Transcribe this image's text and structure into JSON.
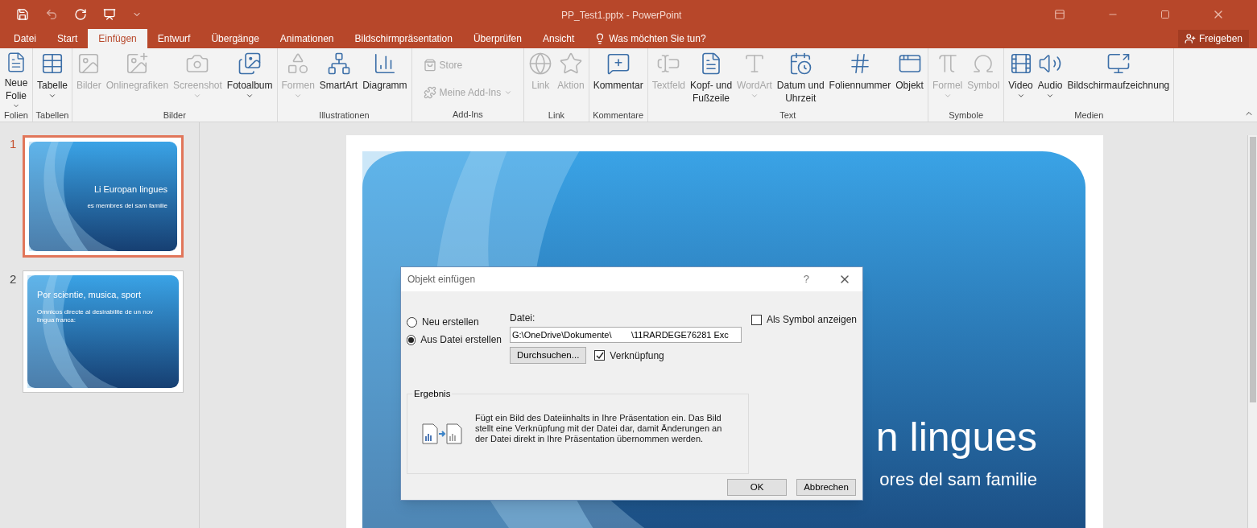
{
  "window": {
    "title": "PP_Test1.pptx - PowerPoint"
  },
  "tabs": [
    {
      "label": "Datei",
      "selected": false
    },
    {
      "label": "Start",
      "selected": false
    },
    {
      "label": "Einfügen",
      "selected": true
    },
    {
      "label": "Entwurf",
      "selected": false
    },
    {
      "label": "Übergänge",
      "selected": false
    },
    {
      "label": "Animationen",
      "selected": false
    },
    {
      "label": "Bildschirmpräsentation",
      "selected": false
    },
    {
      "label": "Überprüfen",
      "selected": false
    },
    {
      "label": "Ansicht",
      "selected": false
    }
  ],
  "tell_me": {
    "placeholder": "Was möchten Sie tun?"
  },
  "share_button": "Freigeben",
  "ribbon": [
    {
      "label": "Folien",
      "items": [
        {
          "kind": "large",
          "label": "Neue\nFolie",
          "disabled": false,
          "dropdown": true
        }
      ]
    },
    {
      "label": "Tabellen",
      "items": [
        {
          "kind": "large",
          "label": "Tabelle",
          "disabled": false,
          "dropdown": true
        }
      ]
    },
    {
      "label": "Bilder",
      "items": [
        {
          "kind": "large",
          "label": "Bilder",
          "disabled": true,
          "dropdown": false
        },
        {
          "kind": "large",
          "label": "Onlinegrafiken",
          "disabled": true,
          "dropdown": false
        },
        {
          "kind": "large",
          "label": "Screenshot",
          "disabled": true,
          "dropdown": true
        },
        {
          "kind": "large",
          "label": "Fotoalbum",
          "disabled": false,
          "dropdown": true
        }
      ]
    },
    {
      "label": "Illustrationen",
      "items": [
        {
          "kind": "large",
          "label": "Formen",
          "disabled": true,
          "dropdown": true
        },
        {
          "kind": "large",
          "label": "SmartArt",
          "disabled": false,
          "dropdown": false
        },
        {
          "kind": "large",
          "label": "Diagramm",
          "disabled": false,
          "dropdown": false
        }
      ]
    },
    {
      "label": "Add-Ins",
      "items": [
        {
          "kind": "small",
          "label": "Store",
          "disabled": true,
          "dropdown": false
        },
        {
          "kind": "small",
          "label": "Meine Add-Ins",
          "disabled": true,
          "dropdown": true
        }
      ]
    },
    {
      "label": "Link",
      "items": [
        {
          "kind": "large",
          "label": "Link",
          "disabled": true,
          "dropdown": false
        },
        {
          "kind": "large",
          "label": "Aktion",
          "disabled": true,
          "dropdown": false
        }
      ]
    },
    {
      "label": "Kommentare",
      "items": [
        {
          "kind": "large",
          "label": "Kommentar",
          "disabled": false,
          "dropdown": false
        }
      ]
    },
    {
      "label": "Text",
      "items": [
        {
          "kind": "large",
          "label": "Textfeld",
          "disabled": true,
          "dropdown": false
        },
        {
          "kind": "large",
          "label": "Kopf- und\nFußzeile",
          "disabled": false,
          "dropdown": false
        },
        {
          "kind": "large",
          "label": "WordArt",
          "disabled": true,
          "dropdown": true
        },
        {
          "kind": "large",
          "label": "Datum und\nUhrzeit",
          "disabled": false,
          "dropdown": false
        },
        {
          "kind": "large",
          "label": "Foliennummer",
          "disabled": false,
          "dropdown": false
        },
        {
          "kind": "large",
          "label": "Objekt",
          "disabled": false,
          "dropdown": false
        }
      ]
    },
    {
      "label": "Symbole",
      "items": [
        {
          "kind": "large",
          "label": "Formel",
          "disabled": true,
          "dropdown": true
        },
        {
          "kind": "large",
          "label": "Symbol",
          "disabled": true,
          "dropdown": false
        }
      ]
    },
    {
      "label": "Medien",
      "items": [
        {
          "kind": "large",
          "label": "Video",
          "disabled": false,
          "dropdown": true
        },
        {
          "kind": "large",
          "label": "Audio",
          "disabled": false,
          "dropdown": true
        },
        {
          "kind": "large",
          "label": "Bildschirmaufzeichnung",
          "disabled": false,
          "dropdown": false
        }
      ]
    }
  ],
  "slides": [
    {
      "number": "1",
      "selected": true,
      "title": "Li Europan lingues",
      "subtitle": "es membres del sam familie"
    },
    {
      "number": "2",
      "selected": false,
      "title": "Por scientie, musica, sport",
      "subtitle": "Omnicos directe al desirabilite de un nov lingua franca:"
    }
  ],
  "current_slide": {
    "title": "n lingues",
    "subtitle": "ores del sam familie"
  },
  "dialog": {
    "title": "Objekt einfügen",
    "help": "?",
    "options": [
      {
        "label": "Neu erstellen",
        "selected": false
      },
      {
        "label": "Aus Datei erstellen",
        "selected": true
      }
    ],
    "file_label": "Datei:",
    "file_value": "G:\\OneDrive\\Dokumente\\        \\11RARDEGE76281 Exc",
    "browse_button": "Durchsuchen...",
    "link_checkbox": {
      "label": "Verknüpfung",
      "checked": true
    },
    "symbol_checkbox": {
      "label": "Als Symbol anzeigen",
      "checked": false
    },
    "result": {
      "label": "Ergebnis",
      "text": "Fügt ein Bild des Dateiinhalts in Ihre Präsentation ein. Das Bild stellt eine Verknüpfung mit der Datei dar, damit Änderungen an der Datei direkt in Ihre Präsentation übernommen werden."
    },
    "buttons": [
      "OK",
      "Abbrechen"
    ]
  }
}
